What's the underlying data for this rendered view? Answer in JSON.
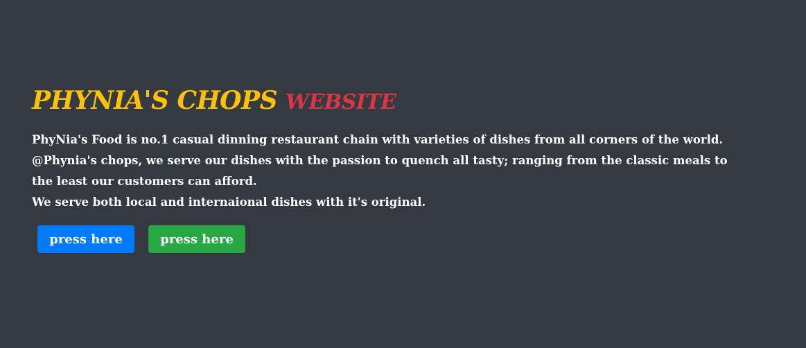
{
  "hero": {
    "title": "PHYNIA'S CHOPS",
    "title_suffix": "WEBSITE",
    "lines": [
      "PhyNia's Food is no.1 casual dinning restaurant chain with varieties of dishes from all corners of the world.",
      "@Phynia's chops, we serve our dishes with the passion to quench all tasty; ranging from the classic meals to",
      "the least our customers can afford.",
      "We serve both local and internaional dishes with it's original."
    ],
    "buttons": [
      {
        "label": "press here",
        "color": "#007bff"
      },
      {
        "label": "press here",
        "color": "#28a745"
      }
    ]
  },
  "colors": {
    "background": "#343a40",
    "title": "#ffc107",
    "title_suffix": "#dc3545"
  }
}
